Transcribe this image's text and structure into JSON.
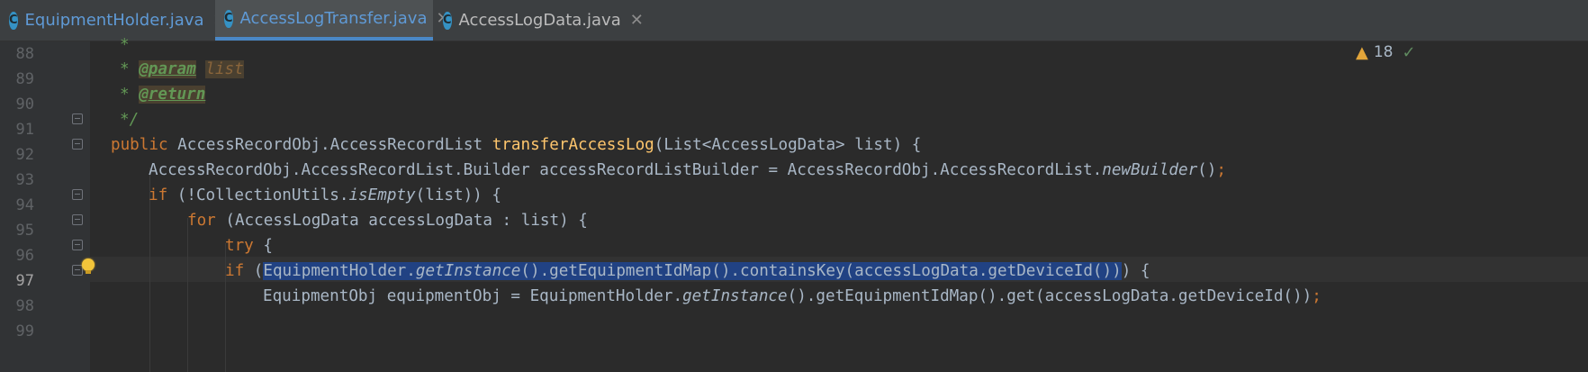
{
  "tabs": [
    {
      "icon": "C",
      "label": "EquipmentHolder.java",
      "close": "✕"
    },
    {
      "icon": "C",
      "label": "AccessLogTransfer.java",
      "close": "✕"
    },
    {
      "icon": "C",
      "label": "AccessLogData.java",
      "close": "✕"
    }
  ],
  "editor": {
    "inspection_count": "18",
    "line_numbers": [
      "88",
      "89",
      "90",
      "91",
      "92",
      "93",
      "94",
      "95",
      "96",
      "97",
      "98",
      "99"
    ],
    "lines": {
      "l88": {
        "star": "*"
      },
      "l89": {
        "star": "* ",
        "tag": "@param",
        "sp": " ",
        "name": "list"
      },
      "l90": {
        "star": "* ",
        "tag": "@return"
      },
      "l91": {
        "end": "*/"
      },
      "l92": {
        "kw": "public",
        "a": " AccessRecordObj.AccessRecordList ",
        "fn": "transferAccessLog",
        "b": "(List<AccessLogData> list) {"
      },
      "l93": {
        "a": "AccessRecordObj.AccessRecordList.Builder accessRecordListBuilder = AccessRecordObj.AccessRecordList.",
        "it": "newBuilder",
        "b": "()",
        "semi": ";"
      },
      "l94": {
        "kw": "if",
        "a": " (!CollectionUtils.",
        "it": "isEmpty",
        "b": "(list)) {"
      },
      "l95": {
        "kw": "for",
        "a": " (AccessLogData accessLogData : list) {"
      },
      "l96": {
        "kw": "try",
        "a": " {"
      },
      "l97": {
        "kw": "if",
        "a": " (",
        "sel1": "EquipmentHolder.",
        "selit": "getInstance",
        "sel2": "().getEquipmentIdMap().containsKey(accessLogData.getDeviceId())",
        "b": ") {"
      },
      "l98": {
        "a": "EquipmentObj equipmentObj = EquipmentHolder.",
        "it": "getInstance",
        "b": "().getEquipmentIdMap().get(accessLogData.getDeviceId())",
        "semi": ";"
      }
    }
  }
}
